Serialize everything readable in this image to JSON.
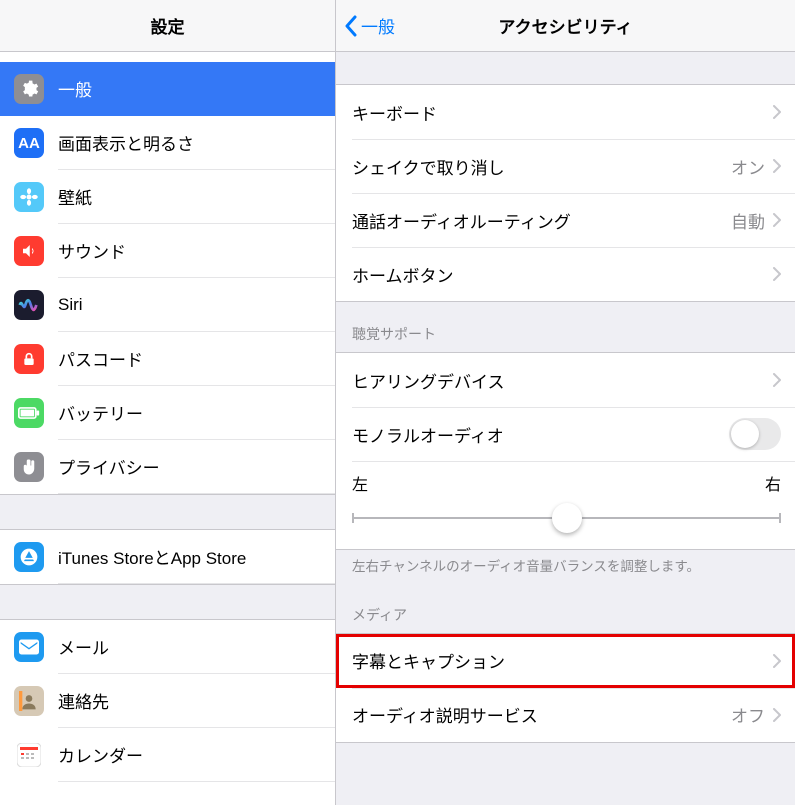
{
  "sidebar": {
    "title": "設定",
    "groups": [
      {
        "items": [
          {
            "id": "general",
            "label": "一般",
            "selected": true,
            "icon": {
              "bg": "#8e8e93",
              "type": "gear"
            }
          },
          {
            "id": "display",
            "label": "画面表示と明るさ",
            "icon": {
              "bg": "#1e6ff6",
              "type": "aa"
            }
          },
          {
            "id": "wallpaper",
            "label": "壁紙",
            "icon": {
              "bg": "#54c9f9",
              "type": "flower"
            }
          },
          {
            "id": "sound",
            "label": "サウンド",
            "icon": {
              "bg": "#ff3b30",
              "type": "speaker"
            }
          },
          {
            "id": "siri",
            "label": "Siri",
            "icon": {
              "bg": "#1b1c2e",
              "type": "siri"
            }
          },
          {
            "id": "passcode",
            "label": "パスコード",
            "icon": {
              "bg": "#ff3b30",
              "type": "lock"
            }
          },
          {
            "id": "battery",
            "label": "バッテリー",
            "icon": {
              "bg": "#4cd964",
              "type": "battery"
            }
          },
          {
            "id": "privacy",
            "label": "プライバシー",
            "icon": {
              "bg": "#8e8e93",
              "type": "hand"
            }
          }
        ]
      },
      {
        "items": [
          {
            "id": "store",
            "label": "iTunes StoreとApp Store",
            "icon": {
              "bg": "#1e9af0",
              "type": "appstore"
            }
          }
        ]
      },
      {
        "items": [
          {
            "id": "mail",
            "label": "メール",
            "icon": {
              "bg": "#1e9af0",
              "type": "mail"
            }
          },
          {
            "id": "contacts",
            "label": "連絡先",
            "icon": {
              "bg": "#d6c9b5",
              "type": "contacts"
            }
          },
          {
            "id": "calendar",
            "label": "カレンダー",
            "icon": {
              "bg": "#ffffff",
              "type": "calendar"
            }
          }
        ]
      }
    ]
  },
  "detail": {
    "back_label": "一般",
    "title": "アクセシビリティ",
    "sections": [
      {
        "rows": [
          {
            "label": "キーボード",
            "chevron": true
          },
          {
            "label": "シェイクで取り消し",
            "value": "オン",
            "chevron": true
          },
          {
            "label": "通話オーディオルーティング",
            "value": "自動",
            "chevron": true
          },
          {
            "label": "ホームボタン",
            "chevron": true
          }
        ]
      },
      {
        "header": "聴覚サポート",
        "rows": [
          {
            "label": "ヒアリングデバイス",
            "chevron": true
          },
          {
            "label": "モノラルオーディオ",
            "switch": true
          },
          {
            "balance": true,
            "left": "左",
            "right": "右"
          }
        ],
        "footer": "左右チャンネルのオーディオ音量バランスを調整します。"
      },
      {
        "header": "メディア",
        "rows": [
          {
            "label": "字幕とキャプション",
            "chevron": true,
            "highlight": true
          },
          {
            "label": "オーディオ説明サービス",
            "value": "オフ",
            "chevron": true
          }
        ]
      }
    ]
  }
}
